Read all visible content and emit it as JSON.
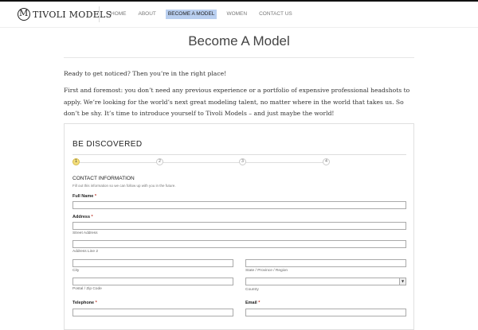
{
  "brand": {
    "name": "TIVOLI MODELS"
  },
  "nav": {
    "items": [
      {
        "label": "HOME"
      },
      {
        "label": "ABOUT"
      },
      {
        "label": "BECOME A MODEL"
      },
      {
        "label": "WOMEN"
      },
      {
        "label": "CONTACT US"
      }
    ],
    "active_index": 2
  },
  "page": {
    "title": "Become A Model",
    "paragraphs": [
      "Ready to get noticed? Then you’re in the right place!",
      "First and foremost: you don’t need any previous experience or a portfolio of expensive professional headshots to apply. We’re looking for the world’s next great modeling talent, no matter where in the world that takes us. So don’t be shy. It’s time to introduce yourself to Tivoli Models – and just maybe the world!"
    ]
  },
  "form": {
    "title": "BE DISCOVERED",
    "steps": [
      "1",
      "2",
      "3",
      "4"
    ],
    "current_step": 1,
    "section_title": "CONTACT INFORMATION",
    "section_desc": "Fill out this information so we can follow up with you in the future.",
    "required_mark": "*",
    "labels": {
      "full_name": "Full Name",
      "address": "Address",
      "telephone": "Telephone",
      "email": "Email"
    },
    "sublabels": {
      "street": "Street Address",
      "line2": "Address Line 2",
      "city": "City",
      "state": "State / Province / Region",
      "zip": "Postal / Zip Code",
      "country": "Country"
    },
    "values": {
      "full_name": "",
      "street": "",
      "line2": "",
      "city": "",
      "state": "",
      "zip": "",
      "country": "",
      "telephone": "",
      "email": ""
    }
  },
  "colors": {
    "nav_active_bg": "#b9cff0",
    "step_current_bg": "#f4de7d",
    "required": "#c0392b"
  }
}
